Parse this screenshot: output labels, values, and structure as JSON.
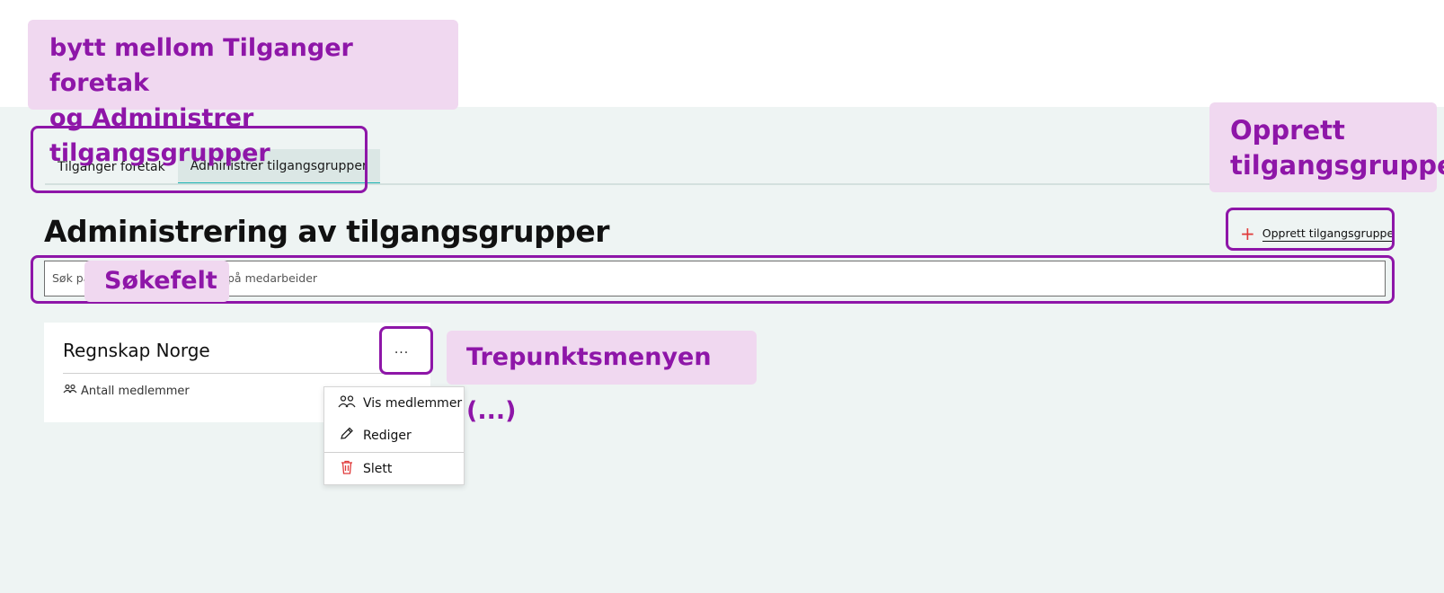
{
  "tabs": [
    {
      "label": "Tilganger foretak",
      "active": false
    },
    {
      "label": "Administrer tilgangsgrupper",
      "active": true
    }
  ],
  "page_title": "Administrering av tilgangsgrupper",
  "create_button": {
    "icon": "plus-icon",
    "label": "Opprett tilgangsgruppe"
  },
  "search": {
    "visible_start": "Søk på",
    "visible_end": "på medarbeider"
  },
  "card": {
    "title": "Regnskap Norge",
    "members_icon": "people-icon",
    "members_label": "Antall medlemmer",
    "menu_button": "..."
  },
  "context_menu": [
    {
      "label": "Vis medlemmer",
      "icon": "people-icon"
    },
    {
      "label": "Rediger",
      "icon": "pencil-icon"
    },
    {
      "label": "Slett",
      "icon": "trash-icon"
    }
  ],
  "annotations": {
    "tabs_note": {
      "line1": "bytt mellom Tilganger foretak",
      "line2": "og Administrer tilgangsgrupper"
    },
    "create_note": {
      "line1": "Opprett",
      "line2": "tilgangsgruppe"
    },
    "search_note": "Søkefelt",
    "menu_note": "Trepunktsmenyen (...)"
  },
  "colors": {
    "annotation": "#8e16a8",
    "annotation_bg": "#f0d8f0",
    "app_bg": "#eef4f3",
    "tab_active_underline": "#19b3b3",
    "danger": "#e03a3a"
  }
}
